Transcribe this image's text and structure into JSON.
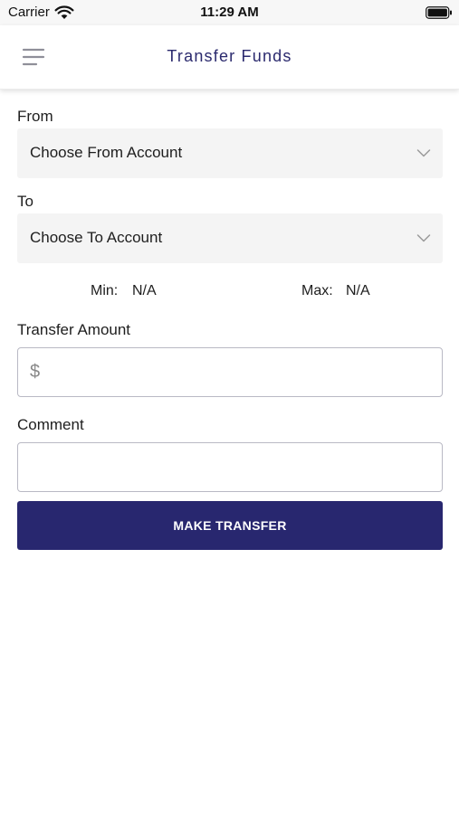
{
  "status_bar": {
    "carrier": "Carrier",
    "time": "11:29 AM",
    "wifi_icon": "wifi-icon",
    "battery_icon": "battery-icon"
  },
  "nav": {
    "title": "Transfer Funds",
    "menu_icon": "hamburger-menu-icon"
  },
  "form": {
    "from_label": "From",
    "from_select": "Choose From Account",
    "to_label": "To",
    "to_select": "Choose To Account",
    "min_label": "Min:",
    "min_value": "N/A",
    "max_label": "Max:",
    "max_value": "N/A",
    "amount_label": "Transfer Amount",
    "currency_symbol": "$",
    "amount_value": "",
    "comment_label": "Comment",
    "comment_value": "",
    "submit_label": "MAKE TRANSFER",
    "select_icon": "chevron-down-icon"
  },
  "colors": {
    "brand": "#28276f",
    "title": "#2b2a6e",
    "select_bg": "#f4f4f4"
  }
}
